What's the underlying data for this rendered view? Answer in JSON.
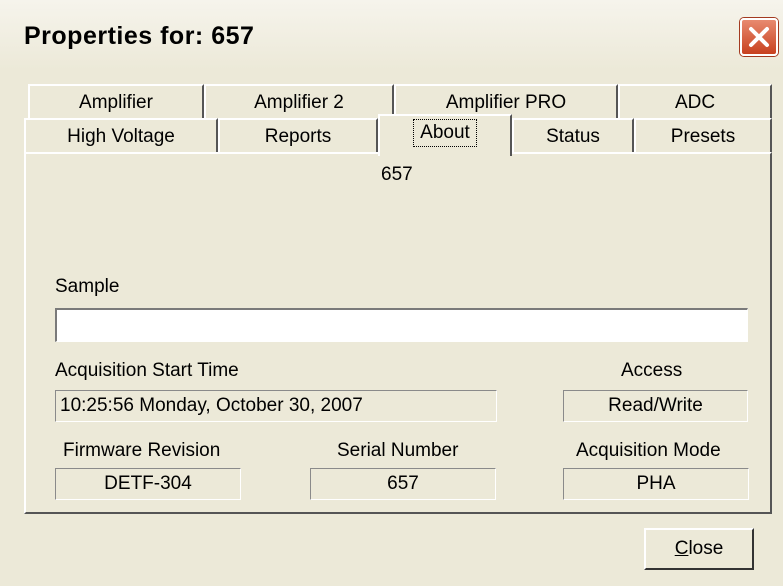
{
  "window": {
    "title": "Properties for: 657",
    "close_icon": "close-x-icon"
  },
  "tabs": {
    "row1": [
      "Amplifier",
      "Amplifier 2",
      "Amplifier PRO",
      "ADC"
    ],
    "row2": [
      "High Voltage",
      "Reports",
      "About",
      "Status",
      "Presets"
    ],
    "active": "About"
  },
  "about": {
    "device_name": "657",
    "sample_label": "Sample",
    "sample_value": "",
    "acq_start_label": "Acquisition Start Time",
    "acq_start_value": "10:25:56 Monday, October 30, 2007",
    "access_label": "Access",
    "access_value": "Read/Write",
    "firmware_label": "Firmware Revision",
    "firmware_value": "DETF-304",
    "serial_label": "Serial Number",
    "serial_value": "657",
    "acq_mode_label": "Acquisition Mode",
    "acq_mode_value": "PHA"
  },
  "buttons": {
    "close_label": "Close",
    "close_mnemonic": "C"
  }
}
